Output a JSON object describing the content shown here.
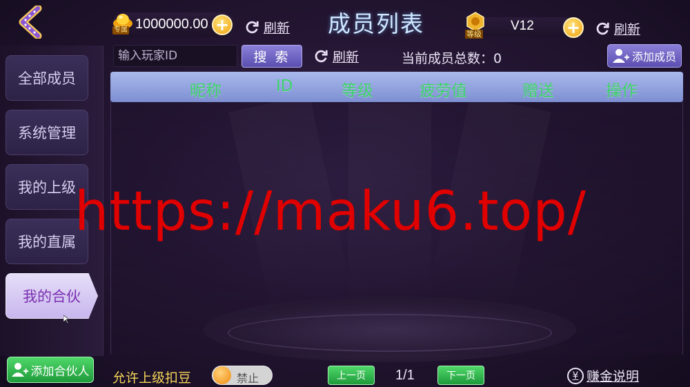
{
  "header": {
    "title": "成员列表",
    "coin_tag": "专属",
    "coin_value": "1000000.00",
    "refresh_label": "刷新",
    "level_tag": "等级",
    "level_value": "V12",
    "refresh_label_2": "刷新"
  },
  "sidebar": {
    "items": [
      {
        "label": "全部成员"
      },
      {
        "label": "系统管理"
      },
      {
        "label": "我的上级"
      },
      {
        "label": "我的直属"
      },
      {
        "label": "我的合伙"
      }
    ],
    "active_index": 4,
    "add_partner_label": "添加合伙人"
  },
  "search": {
    "placeholder": "输入玩家ID",
    "button_label": "搜 索",
    "refresh_label": "刷新",
    "member_count_label": "当前成员总数：0",
    "add_member_label": "添加成员"
  },
  "table": {
    "columns": [
      "昵称",
      "ID",
      "等级",
      "疲劳值",
      "赠送",
      "操作"
    ],
    "rows": []
  },
  "watermark": "https://maku6.top/",
  "footer": {
    "allow_label": "允许上级扣豆",
    "toggle_state_label": "禁止",
    "prev_page_label": "上一页",
    "page_indicator": "1/1",
    "next_page_label": "下一页",
    "earn_label": "赚金说明"
  },
  "colors": {
    "accent_green": "#3dd36a",
    "active_purple": "#7a2fb0",
    "watermark_red": "#e00000",
    "gold": "#f5d55a"
  }
}
